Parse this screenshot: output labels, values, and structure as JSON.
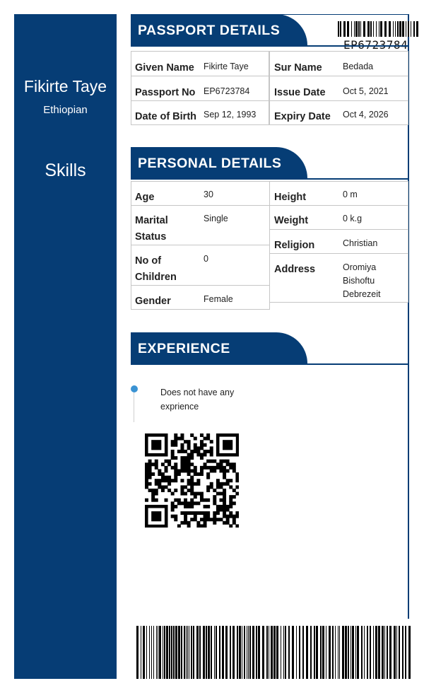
{
  "sidebar": {
    "name": "Fikirte Taye",
    "nationality": "Ethiopian",
    "skills_heading": "Skills"
  },
  "barcode_top_number": "EP6723784",
  "passport": {
    "title": "PASSPORT DETAILS",
    "given_name_label": "Given Name",
    "given_name": "Fikirte Taye",
    "surname_label": "Sur Name",
    "surname": "Bedada",
    "passport_no_label": "Passport No",
    "passport_no": "EP6723784",
    "issue_date_label": "Issue Date",
    "issue_date": "Oct 5, 2021",
    "dob_label": "Date of Birth",
    "dob": "Sep 12, 1993",
    "expiry_label": "Expiry Date",
    "expiry": "Oct 4, 2026"
  },
  "personal": {
    "title": "PERSONAL DETAILS",
    "age_label": "Age",
    "age": "30",
    "marital_label_1": "Marital",
    "marital_label_2": "Status",
    "marital": "Single",
    "children_label_1": "No of",
    "children_label_2": "Children",
    "children": "0",
    "gender_label": "Gender",
    "gender": "Female",
    "height_label": "Height",
    "height": "0 m",
    "weight_label": "Weight",
    "weight": "0 k.g",
    "religion_label": "Religion",
    "religion": "Christian",
    "address_label": "Address",
    "address_1": "Oromiya",
    "address_2": "Bishoftu",
    "address_3": "Debrezeit"
  },
  "experience": {
    "title": "EXPERIENCE",
    "text_1": "Does not have any",
    "text_2": "exprience"
  },
  "colors": {
    "primary": "#063d75",
    "timeline_dot": "#3a93d3"
  }
}
